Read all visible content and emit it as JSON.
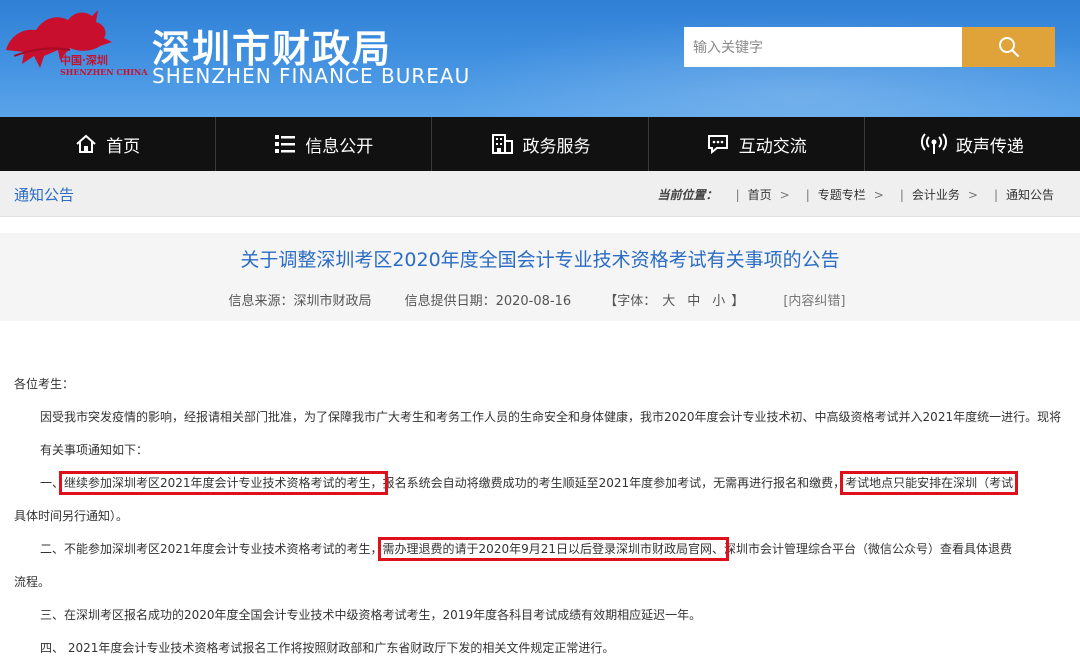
{
  "header": {
    "logo_cn": "中国·深圳",
    "logo_en": "SHENZHEN CHINA",
    "title": "深圳市财政局",
    "subtitle": "SHENZHEN FINANCE BUREAU",
    "search_placeholder": "输入关键字",
    "search_icon": "search-icon",
    "colors": {
      "header_blue": "#3f8fe0",
      "search_button": "#e0a33a"
    }
  },
  "nav": {
    "items": [
      {
        "label": "首页",
        "icon": "home-icon"
      },
      {
        "label": "信息公开",
        "icon": "list-icon"
      },
      {
        "label": "政务服务",
        "icon": "building-icon"
      },
      {
        "label": "互动交流",
        "icon": "chat-icon"
      },
      {
        "label": "政声传递",
        "icon": "broadcast-icon"
      }
    ]
  },
  "breadcrumb": {
    "section": "通知公告",
    "label": "当前位置：",
    "items": [
      "首页",
      "专题专栏",
      "会计业务",
      "通知公告"
    ],
    "separator": ">"
  },
  "article": {
    "title": "关于调整深圳考区2020年度全国会计专业技术资格考试有关事项的公告",
    "source": "信息来源：深圳市财政局",
    "date": "信息提供日期：2020-08-16",
    "font_open": "【字体：",
    "font_large": "大",
    "font_medium": "中",
    "font_small": "小",
    "font_close": "】",
    "correction": "[内容纠错]",
    "greeting": "各位考生：",
    "intro": "因受我市突发疫情的影响，经报请相关部门批准，为了保障我市广大考生和考务工作人员的生命安全和身体健康，我市2020年度会计专业技术初、中高级资格考试并入2021年度统一进行。现将有关事项通知如下：",
    "p1_prefix": "一、",
    "p1_hl1": "继续参加深圳考区2021年度会计专业技术资格考试的考生，",
    "p1_mid": "报名系统会自动将缴费成功的考生顺延至2021年度参加考试，无需再进行报名和缴费，",
    "p1_hl2": "考试地点只能安排在深圳（考试",
    "p1_tail": "具体时间另行通知）。",
    "p2_prefix": "二、不能参加深圳考区2021年度会计专业技术资格考试的考生，",
    "p2_hl": "需办理退费的请于2020年9月21日以后登录深圳市财政局官网、",
    "p2_rest": "深圳市会计管理综合平台（微信公众号）查看具体退费",
    "p2_tail": "流程。",
    "p3": "三、在深圳考区报名成功的2020年度全国会计专业技术中级资格考试考生，2019年度各科目考试成绩有效期相应延迟一年。",
    "p4": "四、 2021年度会计专业技术资格考试报名工作将按照财政部和广东省财政厅下发的相关文件规定正常进行。",
    "highlight_color": "#e0101a",
    "title_color": "#2b6cc4"
  }
}
